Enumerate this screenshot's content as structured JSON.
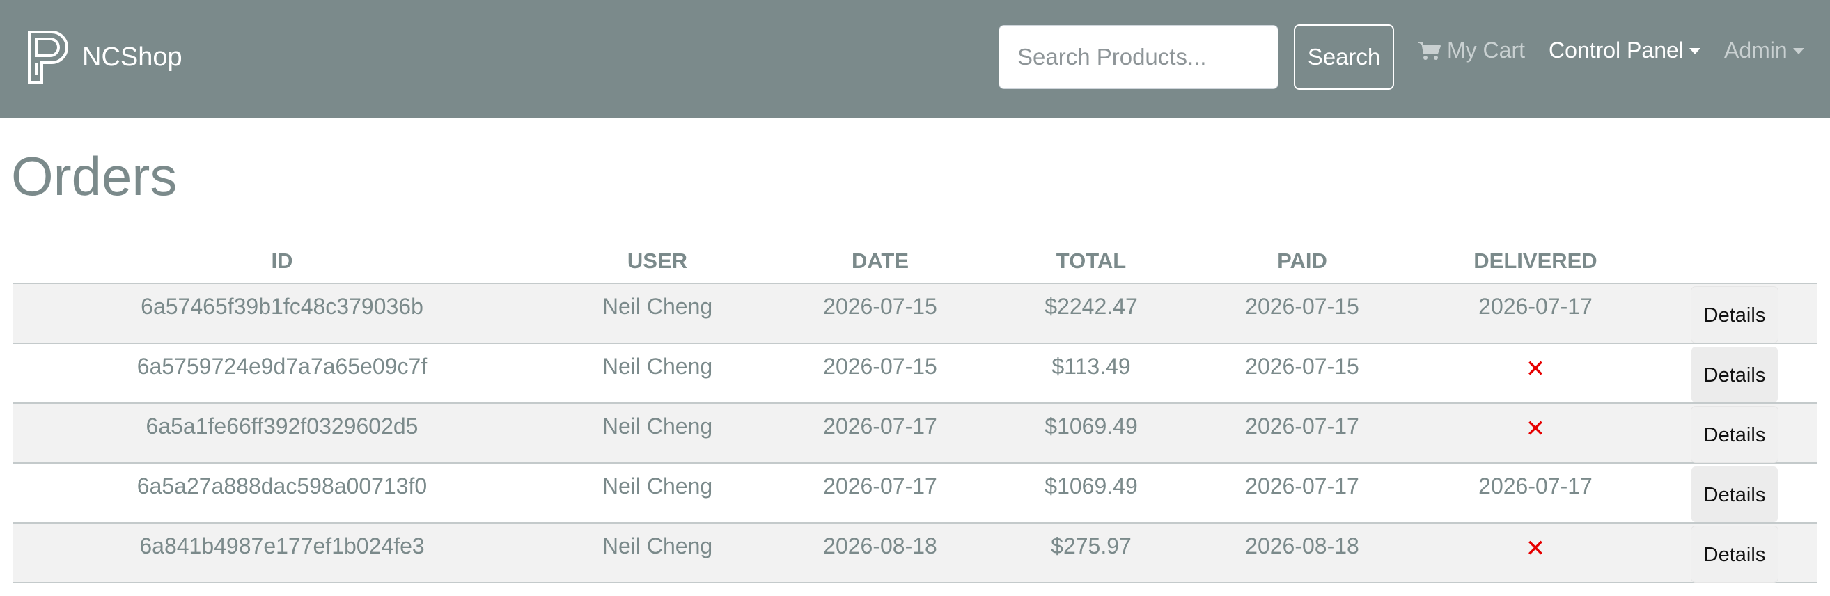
{
  "brand": {
    "name": "NCShop",
    "logo_icon": "ncshop-logo-icon"
  },
  "search": {
    "placeholder": "Search Products...",
    "value": "",
    "button_label": "Search"
  },
  "nav": {
    "cart_label": "My Cart",
    "cart_icon": "shopping-cart-icon",
    "control_panel_label": "Control Panel",
    "admin_label": "Admin"
  },
  "page": {
    "title": "Orders"
  },
  "table": {
    "headers": {
      "id": "ID",
      "user": "USER",
      "date": "DATE",
      "total": "TOTAL",
      "paid": "PAID",
      "delivered": "DELIVERED"
    },
    "details_label": "Details",
    "not_delivered_mark": "✕",
    "rows": [
      {
        "id": "6a57465f39b1fc48c379036b",
        "user": "Neil Cheng",
        "date": "2026-07-15",
        "total": "$2242.47",
        "paid": "2026-07-15",
        "delivered": "2026-07-17"
      },
      {
        "id": "6a5759724e9d7a7a65e09c7f",
        "user": "Neil Cheng",
        "date": "2026-07-15",
        "total": "$113.49",
        "paid": "2026-07-15",
        "delivered": null
      },
      {
        "id": "6a5a1fe66ff392f0329602d5",
        "user": "Neil Cheng",
        "date": "2026-07-17",
        "total": "$1069.49",
        "paid": "2026-07-17",
        "delivered": null
      },
      {
        "id": "6a5a27a888dac598a00713f0",
        "user": "Neil Cheng",
        "date": "2026-07-17",
        "total": "$1069.49",
        "paid": "2026-07-17",
        "delivered": "2026-07-17"
      },
      {
        "id": "6a841b4987e177ef1b024fe3",
        "user": "Neil Cheng",
        "date": "2026-08-18",
        "total": "$275.97",
        "paid": "2026-08-18",
        "delivered": null
      }
    ]
  },
  "colors": {
    "navbar_bg": "#7b8a8b",
    "text_muted": "#7b8a8b",
    "not_delivered": "#e60000",
    "row_stripe": "#f2f2f2"
  }
}
